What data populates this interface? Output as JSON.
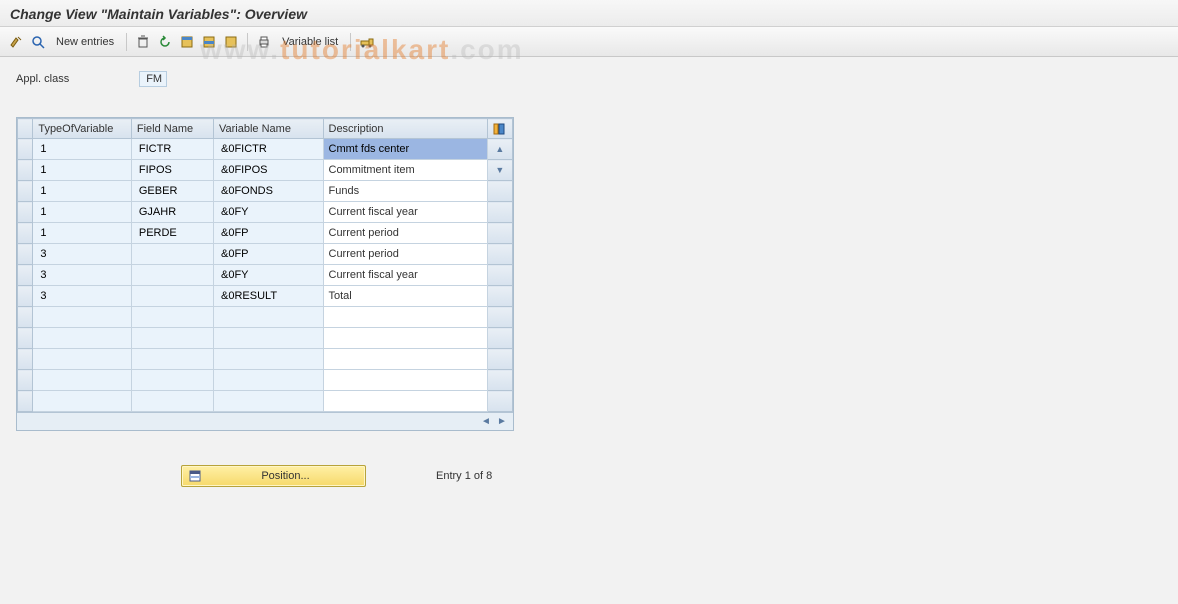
{
  "page_title": "Change View \"Maintain Variables\": Overview",
  "watermark": {
    "pre": "www.",
    "mid": "tutorialkart",
    "post": ".com"
  },
  "toolbar": {
    "new_entries": "New entries",
    "variable_list": "Variable list"
  },
  "appl_class": {
    "label": "Appl. class",
    "value": "FM"
  },
  "table": {
    "headers": {
      "type": "TypeOfVariable",
      "field": "Field Name",
      "var": "Variable Name",
      "desc": "Description"
    },
    "rows": [
      {
        "type": "1",
        "field": "FICTR",
        "var": "&0FICTR",
        "desc": "Cmmt fds center",
        "sel": true
      },
      {
        "type": "1",
        "field": "FIPOS",
        "var": "&0FIPOS",
        "desc": "Commitment item"
      },
      {
        "type": "1",
        "field": "GEBER",
        "var": "&0FONDS",
        "desc": "Funds"
      },
      {
        "type": "1",
        "field": "GJAHR",
        "var": "&0FY",
        "desc": "Current fiscal year"
      },
      {
        "type": "1",
        "field": "PERDE",
        "var": "&0FP",
        "desc": "Current period"
      },
      {
        "type": "3",
        "field": "",
        "var": "&0FP",
        "desc": "Current period"
      },
      {
        "type": "3",
        "field": "",
        "var": "&0FY",
        "desc": "Current fiscal year"
      },
      {
        "type": "3",
        "field": "",
        "var": "&0RESULT",
        "desc": "Total"
      }
    ],
    "empty_rows": 5
  },
  "footer": {
    "position_label": "Position...",
    "entry_text": "Entry 1 of 8"
  }
}
